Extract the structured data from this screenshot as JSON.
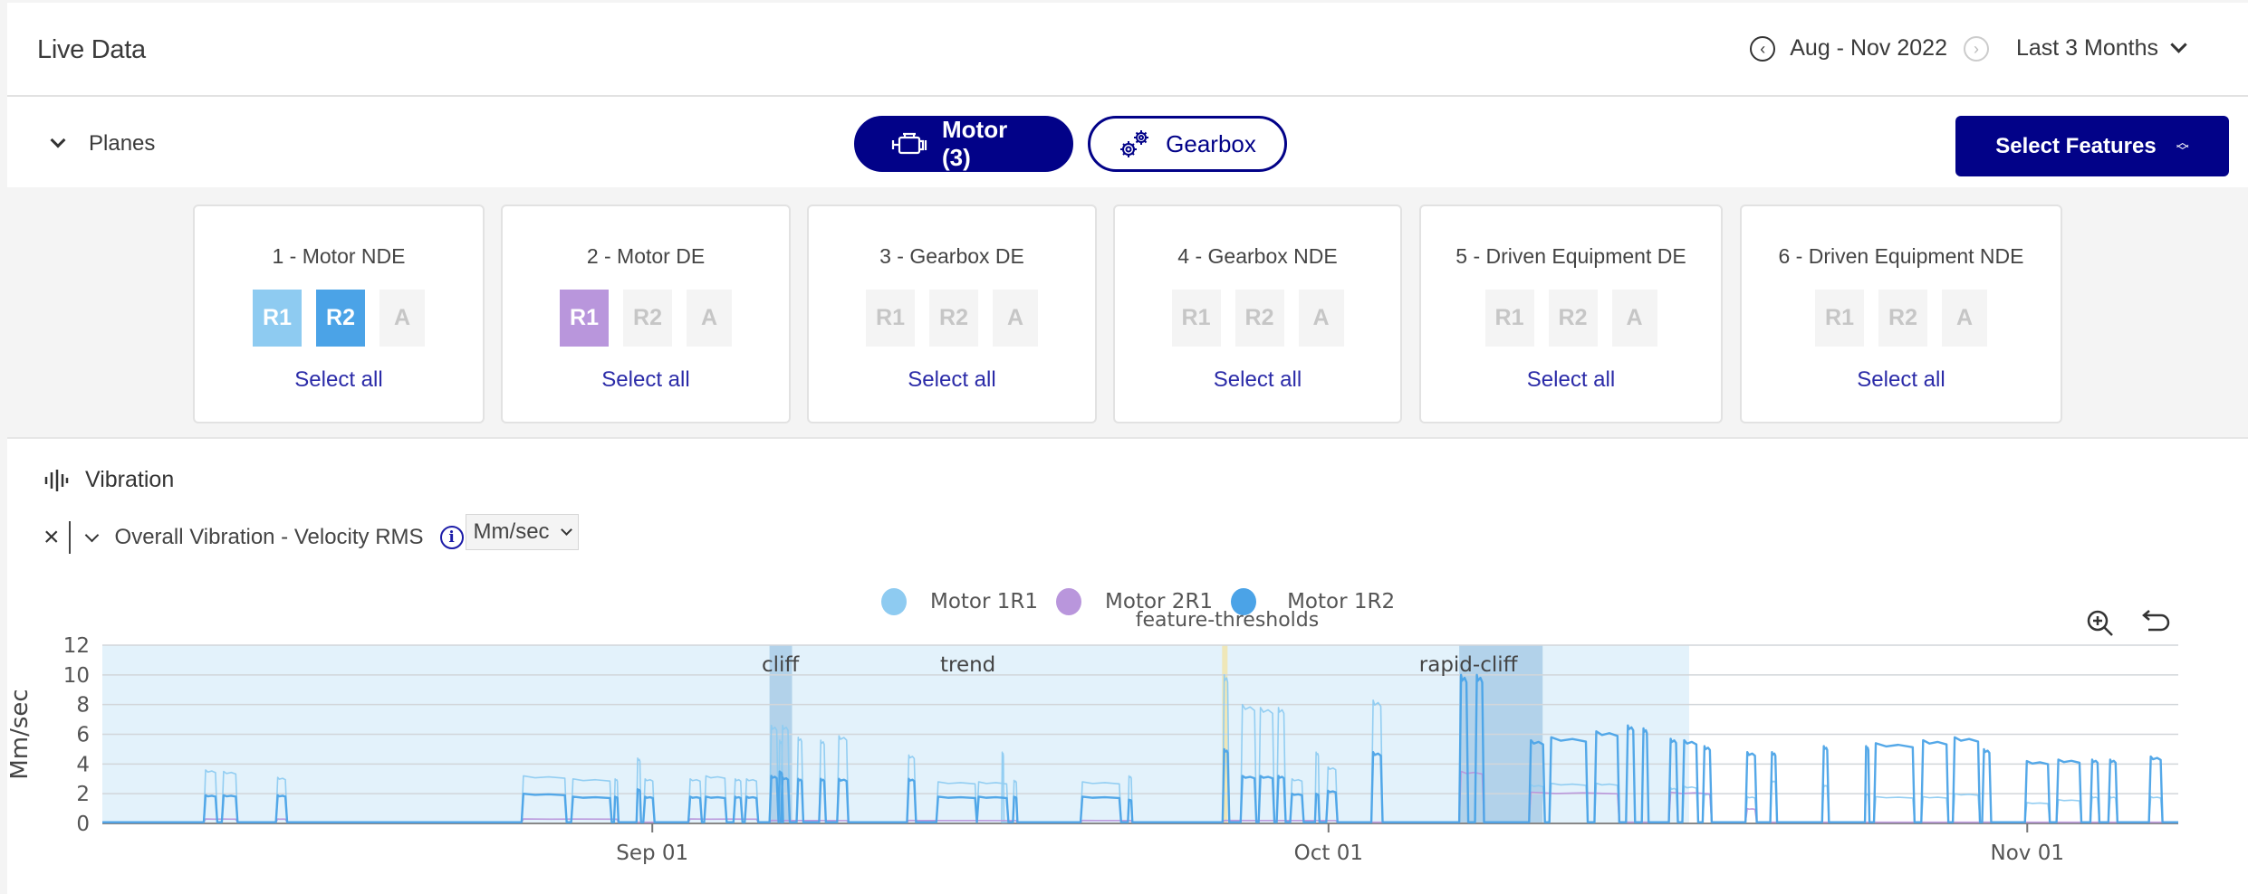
{
  "header": {
    "title": "Live Data",
    "date_range": "Aug - Nov 2022",
    "prev_icon": "chevron-left-circle-icon",
    "next_icon": "chevron-right-circle-icon",
    "period": "Last 3 Months"
  },
  "planes": {
    "toggle_label": "Planes",
    "equipment_tabs": [
      {
        "label": "Motor (3)",
        "icon": "motor-icon",
        "active": true
      },
      {
        "label": "Gearbox",
        "icon": "gears-icon",
        "active": false
      }
    ],
    "select_features_label": "Select Features",
    "cards": [
      {
        "title": "1 - Motor NDE",
        "chips": [
          {
            "label": "R1",
            "state": "light-blue"
          },
          {
            "label": "R2",
            "state": "blue"
          },
          {
            "label": "A",
            "state": "off"
          }
        ],
        "select_all": "Select all"
      },
      {
        "title": "2 - Motor DE",
        "chips": [
          {
            "label": "R1",
            "state": "purple"
          },
          {
            "label": "R2",
            "state": "off"
          },
          {
            "label": "A",
            "state": "off"
          }
        ],
        "select_all": "Select all"
      },
      {
        "title": "3 - Gearbox DE",
        "chips": [
          {
            "label": "R1",
            "state": "off"
          },
          {
            "label": "R2",
            "state": "off"
          },
          {
            "label": "A",
            "state": "off"
          }
        ],
        "select_all": "Select all"
      },
      {
        "title": "4 - Gearbox NDE",
        "chips": [
          {
            "label": "R1",
            "state": "off"
          },
          {
            "label": "R2",
            "state": "off"
          },
          {
            "label": "A",
            "state": "off"
          }
        ],
        "select_all": "Select all"
      },
      {
        "title": "5 - Driven Equipment DE",
        "chips": [
          {
            "label": "R1",
            "state": "off"
          },
          {
            "label": "R2",
            "state": "off"
          },
          {
            "label": "A",
            "state": "off"
          }
        ],
        "select_all": "Select all"
      },
      {
        "title": "6 - Driven Equipment NDE",
        "chips": [
          {
            "label": "R1",
            "state": "off"
          },
          {
            "label": "R2",
            "state": "off"
          },
          {
            "label": "A",
            "state": "off"
          }
        ],
        "select_all": "Select all"
      }
    ]
  },
  "vibration": {
    "section_label": "Vibration",
    "feature_label": "Overall Vibration - Velocity RMS",
    "unit_selected": "Mm/sec"
  },
  "colors": {
    "brand": "#020288",
    "motor_1r1": "#8ecbf1",
    "motor_2r1": "#b996dc",
    "motor_1r2": "#4ba3e7",
    "threshold_band": "#e3f2fb",
    "event_band": "#a9cde6",
    "threshold_line": "#efe6b0"
  },
  "chart_data": {
    "type": "line",
    "title": "",
    "xlabel": "",
    "ylabel": "Mm/sec",
    "ylim": [
      0,
      12
    ],
    "yticks": [
      "0",
      "2",
      "4",
      "6",
      "8",
      "10",
      "12"
    ],
    "xlim_days_from_sep01": [
      -24.4,
      67.7
    ],
    "xticks": [
      {
        "label": "Sep 01",
        "day": 0
      },
      {
        "label": "Oct 01",
        "day": 30
      },
      {
        "label": "Nov 01",
        "day": 61
      }
    ],
    "grid": true,
    "legend_position": "top-center",
    "legend": [
      "Motor 1R1",
      "Motor 2R1",
      "Motor 1R2"
    ],
    "threshold_label": "feature-thresholds",
    "threshold_region_days": [
      -24.4,
      46.0
    ],
    "annotations": [
      {
        "label": "cliff",
        "start_day": 5.2,
        "end_day": 6.2
      },
      {
        "label": "trend",
        "start_day": 14.0,
        "end_day": 14.0
      },
      {
        "label": "rapid-cliff",
        "start_day": 35.8,
        "end_day": 39.5
      }
    ],
    "threshold_marker_day": 25.4,
    "series": [
      {
        "name": "Motor 1R1",
        "color": "#8ecbf1",
        "bursts": [
          [
            -19.9,
            -19.3,
            3.6
          ],
          [
            -19.1,
            -18.4,
            3.5
          ],
          [
            -16.7,
            -16.2,
            3.1
          ],
          [
            -5.8,
            -3.8,
            3.2
          ],
          [
            -3.6,
            -1.8,
            3.0
          ],
          [
            -1.7,
            -1.5,
            3.0
          ],
          [
            -0.7,
            -0.5,
            4.4
          ],
          [
            -0.4,
            0.1,
            3.0
          ],
          [
            1.6,
            2.2,
            3.0
          ],
          [
            2.3,
            3.3,
            3.2
          ],
          [
            3.6,
            4.0,
            3.0
          ],
          [
            4.1,
            4.7,
            3.0
          ],
          [
            5.6,
            5.8,
            5.6
          ],
          [
            5.2,
            5.6,
            6.6
          ],
          [
            5.7,
            6.1,
            6.6
          ],
          [
            6.4,
            6.7,
            5.8
          ],
          [
            7.4,
            7.7,
            5.6
          ],
          [
            8.2,
            8.7,
            5.9
          ],
          [
            11.3,
            11.7,
            4.6
          ],
          [
            12.6,
            14.4,
            2.8
          ],
          [
            14.4,
            15.8,
            2.8
          ],
          [
            15.5,
            15.6,
            4.8
          ],
          [
            16.0,
            16.2,
            2.9
          ],
          [
            19.0,
            20.8,
            2.8
          ],
          [
            21.1,
            21.3,
            3.2
          ],
          [
            25.3,
            25.6,
            10.0
          ],
          [
            26.1,
            26.8,
            8.0
          ],
          [
            26.9,
            27.6,
            7.8
          ],
          [
            27.7,
            28.1,
            7.8
          ],
          [
            28.3,
            28.9,
            3.0
          ],
          [
            29.4,
            29.6,
            4.8
          ],
          [
            29.9,
            30.4,
            3.8
          ],
          [
            31.9,
            32.4,
            8.3
          ],
          [
            35.8,
            36.2,
            10.0
          ],
          [
            36.5,
            36.9,
            10.0
          ],
          [
            38.9,
            39.6,
            2.6
          ],
          [
            39.8,
            41.5,
            2.7
          ],
          [
            41.8,
            42.9,
            2.7
          ],
          [
            45.1,
            45.5,
            2.4
          ],
          [
            45.7,
            46.4,
            2.5
          ],
          [
            46.6,
            47.0,
            2.0
          ],
          [
            48.5,
            49.0,
            1.8
          ],
          [
            49.6,
            49.9,
            2.9
          ],
          [
            51.9,
            52.2,
            2.6
          ],
          [
            53.8,
            54.0,
            2.0
          ],
          [
            54.2,
            56.0,
            1.8
          ],
          [
            56.3,
            57.5,
            1.8
          ],
          [
            57.7,
            58.9,
            2.0
          ],
          [
            60.9,
            62.0,
            1.4
          ],
          [
            62.3,
            63.4,
            1.6
          ],
          [
            63.8,
            64.2,
            1.8
          ],
          [
            64.6,
            65.0,
            1.8
          ],
          [
            66.4,
            67.0,
            1.8
          ]
        ]
      },
      {
        "name": "Motor 2R1",
        "color": "#b996dc",
        "bursts": [
          [
            -19.9,
            -18.4,
            0.3
          ],
          [
            -16.7,
            -16.2,
            0.3
          ],
          [
            -5.8,
            -1.5,
            0.3
          ],
          [
            1.6,
            4.7,
            0.3
          ],
          [
            5.2,
            8.7,
            0.2
          ],
          [
            11.3,
            16.2,
            0.2
          ],
          [
            19.0,
            21.3,
            0.2
          ],
          [
            25.3,
            30.4,
            0.2
          ],
          [
            35.8,
            36.9,
            3.5
          ],
          [
            38.9,
            42.9,
            2.1
          ],
          [
            45.1,
            47.0,
            2.1
          ],
          [
            48.5,
            49.0,
            1.0
          ]
        ]
      },
      {
        "name": "Motor 1R2",
        "color": "#4ba3e7",
        "bursts": [
          [
            -19.9,
            -19.3,
            1.9
          ],
          [
            -19.1,
            -18.4,
            1.9
          ],
          [
            -16.7,
            -16.2,
            1.9
          ],
          [
            -5.8,
            -3.8,
            2.0
          ],
          [
            -3.6,
            -1.8,
            1.8
          ],
          [
            -1.7,
            -1.5,
            1.8
          ],
          [
            -0.7,
            -0.5,
            2.3
          ],
          [
            -0.4,
            0.1,
            1.8
          ],
          [
            1.6,
            2.2,
            1.8
          ],
          [
            2.3,
            3.3,
            1.8
          ],
          [
            3.6,
            4.0,
            1.8
          ],
          [
            4.1,
            4.7,
            1.8
          ],
          [
            5.6,
            5.8,
            3.5
          ],
          [
            5.2,
            5.6,
            3.2
          ],
          [
            5.7,
            6.1,
            3.1
          ],
          [
            6.4,
            6.7,
            3.0
          ],
          [
            7.4,
            7.7,
            3.0
          ],
          [
            8.2,
            8.7,
            3.0
          ],
          [
            11.3,
            11.7,
            3.0
          ],
          [
            12.6,
            14.4,
            1.8
          ],
          [
            14.4,
            15.8,
            1.8
          ],
          [
            16.0,
            16.2,
            1.8
          ],
          [
            19.0,
            20.8,
            1.8
          ],
          [
            21.1,
            21.3,
            1.6
          ],
          [
            25.3,
            25.6,
            5.0
          ],
          [
            26.1,
            26.8,
            3.2
          ],
          [
            26.9,
            27.6,
            3.2
          ],
          [
            27.7,
            28.1,
            3.2
          ],
          [
            28.3,
            28.9,
            2.0
          ],
          [
            29.4,
            29.6,
            2.0
          ],
          [
            29.9,
            30.4,
            2.2
          ],
          [
            31.9,
            32.4,
            4.8
          ],
          [
            35.8,
            36.2,
            10.0
          ],
          [
            36.5,
            36.9,
            10.0
          ],
          [
            38.9,
            39.6,
            5.6
          ],
          [
            39.8,
            41.5,
            5.8
          ],
          [
            41.8,
            42.9,
            6.2
          ],
          [
            43.2,
            43.6,
            6.6
          ],
          [
            43.9,
            44.2,
            6.4
          ],
          [
            45.1,
            45.5,
            5.7
          ],
          [
            45.7,
            46.4,
            5.6
          ],
          [
            46.6,
            47.0,
            5.2
          ],
          [
            48.5,
            49.0,
            4.8
          ],
          [
            49.6,
            49.9,
            4.8
          ],
          [
            51.9,
            52.2,
            5.2
          ],
          [
            53.8,
            54.0,
            5.2
          ],
          [
            54.2,
            56.0,
            5.4
          ],
          [
            56.3,
            57.5,
            5.6
          ],
          [
            57.7,
            58.9,
            5.8
          ],
          [
            59.0,
            59.4,
            5.0
          ],
          [
            60.9,
            62.0,
            4.2
          ],
          [
            62.3,
            63.4,
            4.3
          ],
          [
            63.8,
            64.2,
            4.3
          ],
          [
            64.6,
            65.0,
            4.3
          ],
          [
            66.4,
            67.0,
            4.5
          ]
        ]
      }
    ]
  }
}
